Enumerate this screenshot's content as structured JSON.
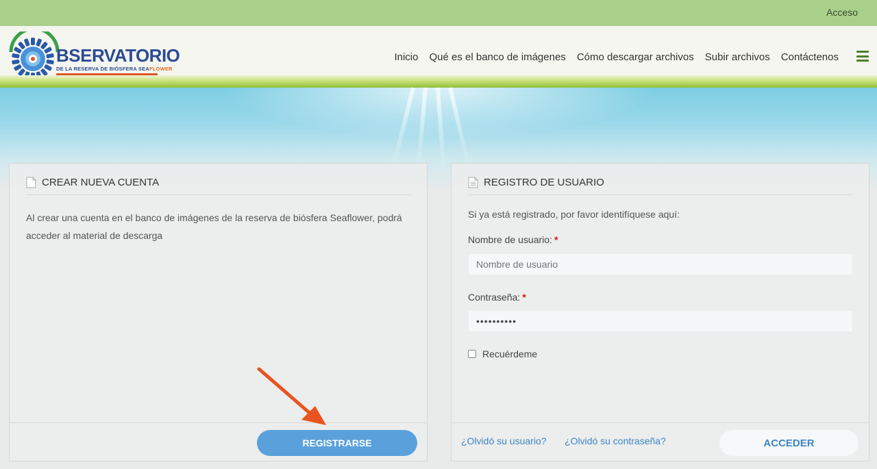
{
  "topbar": {
    "login_link": "Acceso"
  },
  "logo": {
    "wordmark": "BSERVATORIO",
    "tagline_main": "DE LA RESERVA DE BIÓSFERA SEA",
    "tagline_accent": "FLOWER"
  },
  "nav": {
    "items": [
      "Inicio",
      "Qué es el banco de imágenes",
      "Cómo descargar archivos",
      "Subir archivos",
      "Contáctenos"
    ]
  },
  "create_account": {
    "title": "CREAR NUEVA CUENTA",
    "description": "Al crear una cuenta en el banco de imágenes de la reserva de biósfera Seaflower, podrá acceder al material de descarga",
    "register_button": "REGISTRARSE"
  },
  "login": {
    "title": "REGISTRO DE USUARIO",
    "intro": "Si ya está registrado, por favor identifíquese aquí:",
    "username_label": "Nombre de usuario:",
    "username_placeholder": "Nombre de usuario",
    "password_label": "Contraseña:",
    "password_value": "••••••••••",
    "required_mark": "*",
    "remember_label": "Recuérdeme",
    "forgot_user": "¿Olvidó su usuario?",
    "forgot_password": "¿Olvidó su contraseña?",
    "submit_button": "ACCEDER"
  },
  "colors": {
    "topbar": "#a8d08a",
    "accent_blue": "#5aa1dc",
    "link_blue": "#3d86c6",
    "arrow_orange": "#e8531f"
  }
}
